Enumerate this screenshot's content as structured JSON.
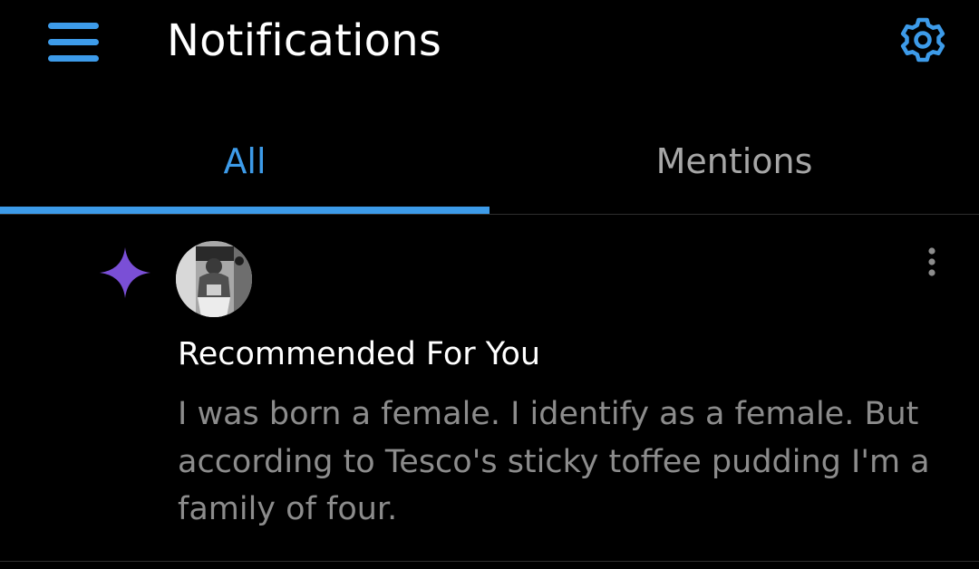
{
  "header": {
    "title": "Notifications",
    "menu_icon": "hamburger-menu-icon",
    "settings_icon": "gear-icon"
  },
  "tabs": [
    {
      "label": "All",
      "active": true
    },
    {
      "label": "Mentions",
      "active": false
    }
  ],
  "notifications": [
    {
      "icon": "sparkle-icon",
      "avatar": "user-avatar",
      "title": "Recommended For You",
      "body": "I was born a female. I identify as a female. But according to Tesco's sticky toffee pudding I'm a family of four.",
      "menu_icon": "more-vertical-icon"
    }
  ],
  "colors": {
    "background": "#000000",
    "accent": "#3d9be9",
    "inactive_tab": "#a6a6a6",
    "body_text": "#8c8c8c",
    "sparkle": "#7a4fd6",
    "divider": "#2e2e2e"
  }
}
